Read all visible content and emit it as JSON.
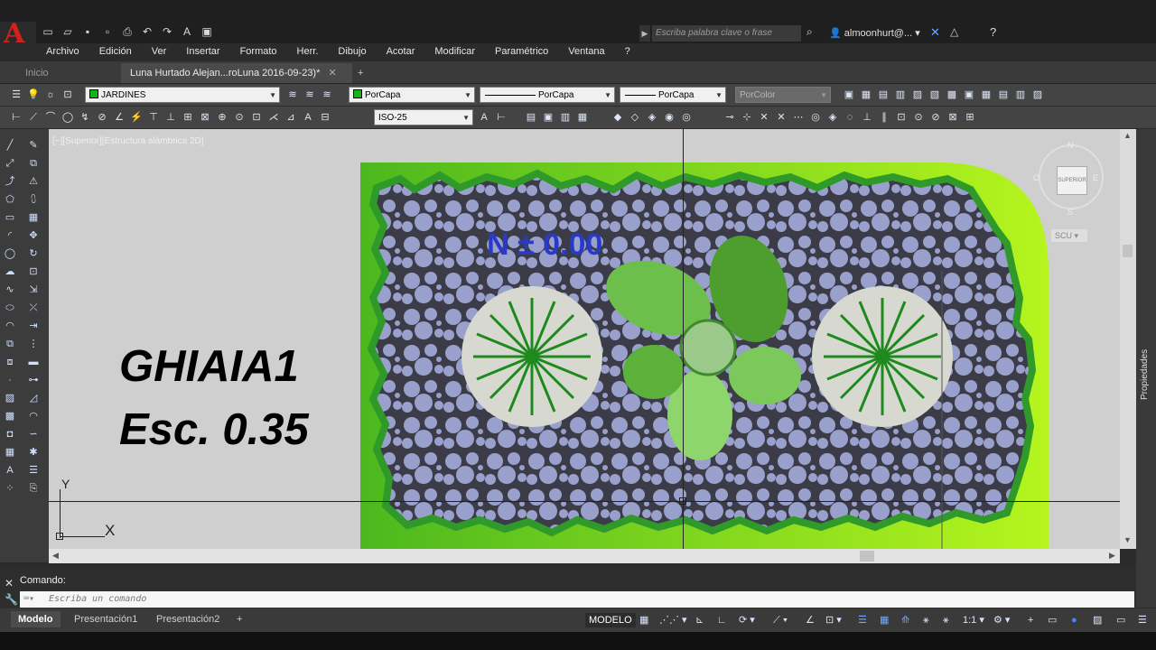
{
  "titlebar": {
    "search_placeholder": "Escriba palabra clave o frase",
    "user": "almoonhurt@...",
    "help_icon": "help-icon"
  },
  "menu": [
    "Archivo",
    "Edición",
    "Ver",
    "Insertar",
    "Formato",
    "Herr.",
    "Dibujo",
    "Acotar",
    "Modificar",
    "Paramétrico",
    "Ventana",
    "?"
  ],
  "tabs": {
    "start": "Inicio",
    "document": "Luna Hurtado Alejan...roLuna 2016-09-23)*"
  },
  "toolbar": {
    "layer": "JARDINES",
    "color": "PorCapa",
    "linetype": "PorCapa",
    "lineweight": "PorCapa",
    "plotstyle": "PorColor",
    "dimstyle": "ISO-25"
  },
  "viewport": {
    "label": "[−][Superior][Estructura alámbrica 2D]",
    "drawing_title": "GHIAIA1",
    "drawing_scale": "Esc. 0.35",
    "level_text": "N ± 0.00",
    "ucs_x": "X",
    "ucs_y": "Y",
    "viewcube": {
      "top": "SUPERIOR",
      "n": "N",
      "s": "S",
      "e": "E",
      "o": "O",
      "ucs": "SCU"
    }
  },
  "side_panel": "Propiedades",
  "command": {
    "label": "Comando:",
    "placeholder": "Escriba un comando"
  },
  "layout_tabs": [
    "Modelo",
    "Presentación1",
    "Presentación2"
  ],
  "status": {
    "mode": "MODELO",
    "scale": "1:1"
  },
  "colors": {
    "layer_swatch": "#19b319",
    "ground": "#9be21e",
    "gravel": "#9aa0cc"
  }
}
